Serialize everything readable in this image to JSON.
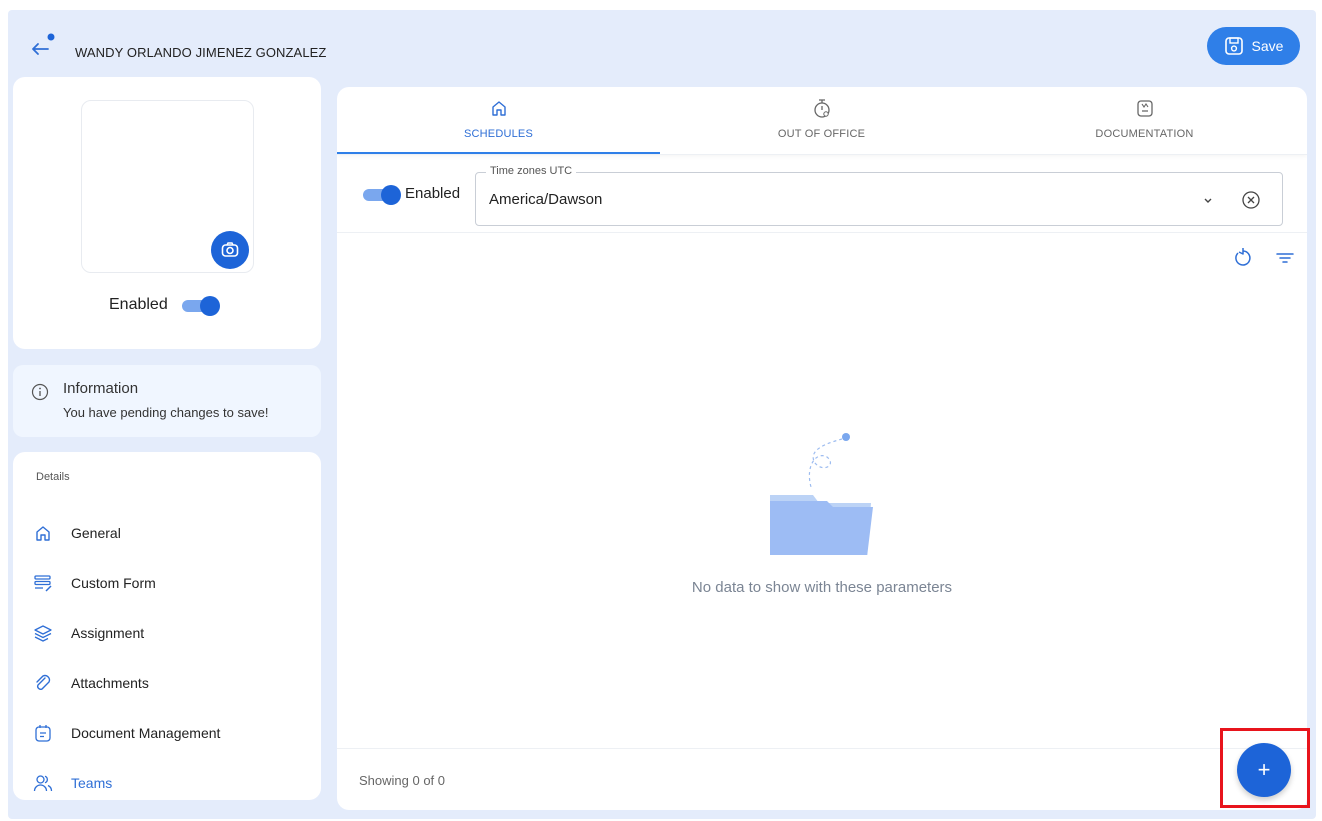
{
  "header": {
    "title": "WANDY ORLANDO JIMENEZ GONZALEZ",
    "save_label": "Save"
  },
  "profile": {
    "enabled_label": "Enabled",
    "enabled": true
  },
  "info": {
    "title": "Information",
    "message": "You have pending changes to save!"
  },
  "details": {
    "section_label": "Details",
    "items": [
      {
        "label": "General",
        "icon": "home-icon"
      },
      {
        "label": "Custom Form",
        "icon": "form-icon"
      },
      {
        "label": "Assignment",
        "icon": "layers-icon"
      },
      {
        "label": "Attachments",
        "icon": "paperclip-icon"
      },
      {
        "label": "Document Management",
        "icon": "document-icon"
      },
      {
        "label": "Teams",
        "icon": "users-icon",
        "active": true
      }
    ]
  },
  "tabs": [
    {
      "label": "SCHEDULES",
      "icon": "home-icon",
      "active": true
    },
    {
      "label": "OUT OF OFFICE",
      "icon": "timer-icon"
    },
    {
      "label": "DOCUMENTATION",
      "icon": "document-icon"
    }
  ],
  "filters": {
    "enabled_label": "Enabled",
    "timezone_legend": "Time zones UTC",
    "timezone_value": "America/Dawson"
  },
  "empty_state": {
    "message": "No data to show with these parameters"
  },
  "footer": {
    "showing": "Showing 0 of 0"
  },
  "fab": {
    "label": "+"
  },
  "colors": {
    "accent": "#2f7fe8",
    "primary_dark": "#1d64d8",
    "background": "#e4ecfb",
    "highlight": "#e8141c"
  }
}
